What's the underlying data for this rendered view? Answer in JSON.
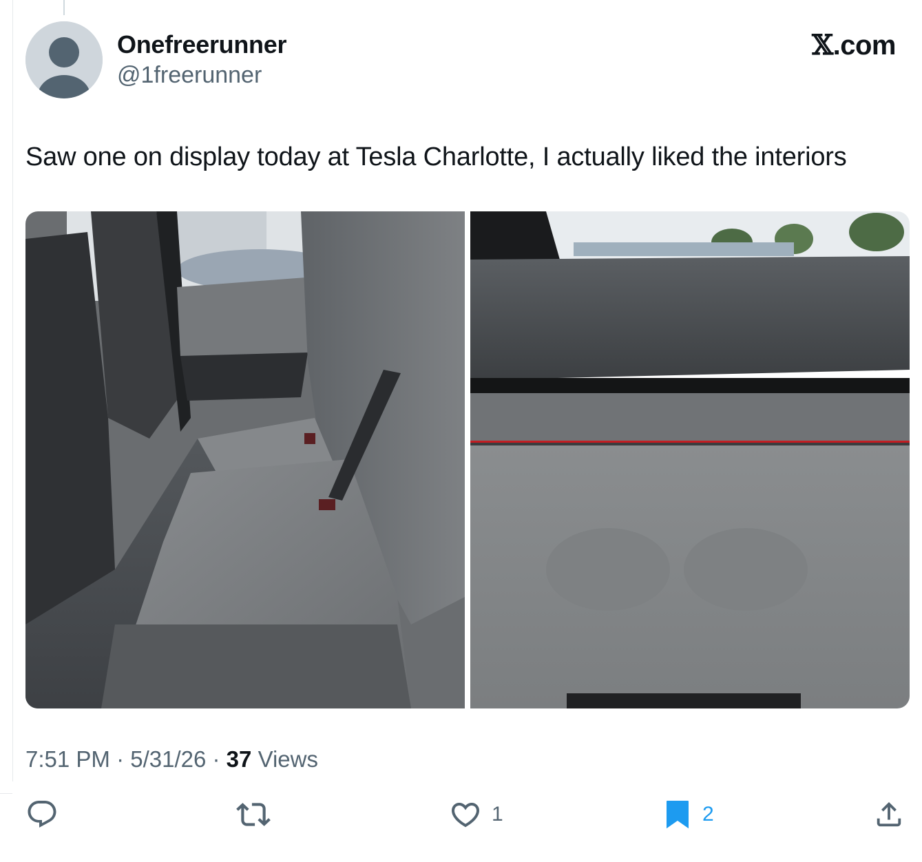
{
  "author": {
    "display_name": "Onefreerunner",
    "handle": "@1freerunner",
    "avatar_icon": "default-avatar-icon"
  },
  "brand": {
    "mark": "𝕏",
    "suffix": ".com"
  },
  "tweet": {
    "text": "Saw one on display today at Tesla Charlotte, I actually liked the interiors"
  },
  "media": [
    {
      "kind": "photo",
      "subject": "rear seat interior"
    },
    {
      "kind": "photo",
      "subject": "dashboard close-up"
    }
  ],
  "meta": {
    "time": "7:51 PM",
    "date": "5/31/26",
    "separator": " · ",
    "views_count": "37",
    "views_label": "Views"
  },
  "actions": {
    "reply": {
      "icon": "reply-icon",
      "count": ""
    },
    "repost": {
      "icon": "repost-icon",
      "count": ""
    },
    "like": {
      "icon": "heart-icon",
      "count": "1"
    },
    "bookmark": {
      "icon": "bookmark-icon",
      "count": "2",
      "color": "#1d9bf0"
    },
    "share": {
      "icon": "share-icon"
    }
  },
  "colors": {
    "text_primary": "#0f1419",
    "text_secondary": "#536471",
    "accent": "#1d9bf0"
  }
}
